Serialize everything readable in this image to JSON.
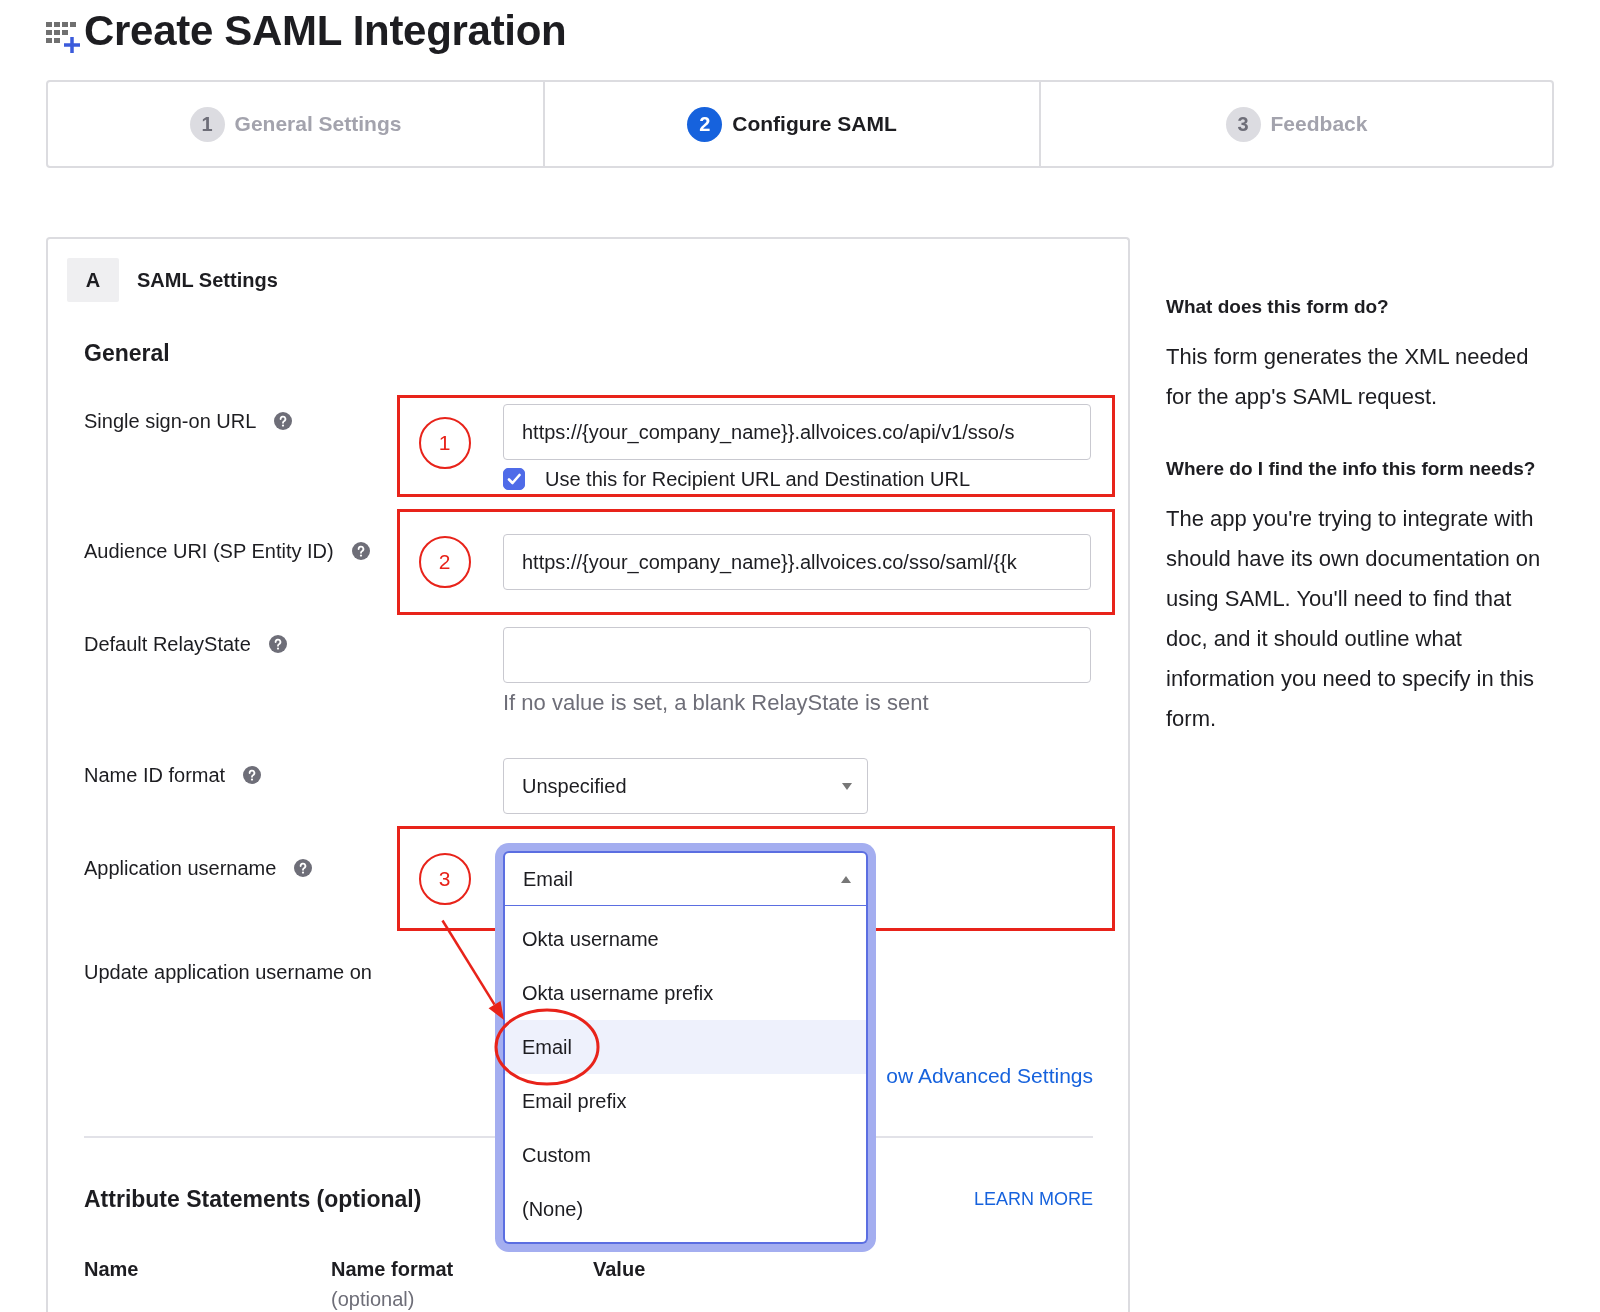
{
  "page": {
    "title": "Create SAML Integration"
  },
  "steps": [
    {
      "number": "1",
      "label": "General Settings",
      "selected": false
    },
    {
      "number": "2",
      "label": "Configure SAML",
      "selected": true
    },
    {
      "number": "3",
      "label": "Feedback",
      "selected": false
    }
  ],
  "card": {
    "badge": "A",
    "title": "SAML Settings",
    "section": "General",
    "fields": [
      {
        "kind": "text",
        "label": "Single sign-on URL",
        "help": true,
        "annotation": "1",
        "value": "https://{your_company_name}}.allvoices.co/api/v1/sso/s",
        "checkbox": {
          "label": "Use this for Recipient URL and Destination URL",
          "checked": true
        }
      },
      {
        "kind": "text",
        "label": "Audience URI (SP Entity ID)",
        "help": true,
        "annotation": "2",
        "value": "https://{your_company_name}}.allvoices.co/sso/saml/{{k"
      },
      {
        "kind": "text",
        "label": "Default RelayState",
        "help": true,
        "hint": "If no value is set, a blank RelayState is sent"
      },
      {
        "kind": "select",
        "label": "Name ID format",
        "help": true,
        "value": "Unspecified",
        "expanded": false
      },
      {
        "kind": "select",
        "label": "Application username",
        "help": true,
        "annotation": "3",
        "value": "Email",
        "expanded": true,
        "options": [
          {
            "label": "Okta username",
            "selected": false
          },
          {
            "label": "Okta username prefix",
            "selected": false
          },
          {
            "label": "Email",
            "selected": true,
            "circled": true
          },
          {
            "label": "Email prefix",
            "selected": false
          },
          {
            "label": "Custom",
            "selected": false
          },
          {
            "label": "(None)",
            "selected": false
          }
        ]
      },
      {
        "kind": "label",
        "label": "Update application username on"
      }
    ],
    "advanced_link": "ow Advanced Settings",
    "attributes": {
      "title": "Attribute Statements (optional)",
      "link": "LEARN MORE",
      "columns": [
        {
          "label": "Name"
        },
        {
          "label": "Name format",
          "note": "(optional)"
        },
        {
          "label": "Value"
        }
      ]
    }
  },
  "help_panel": [
    {
      "kind": "heading",
      "text": "What does this form do?"
    },
    {
      "kind": "paragraph",
      "text": "This form generates the XML needed for the app's SAML request."
    },
    {
      "kind": "heading",
      "text": "Where do I find the info this form needs?"
    },
    {
      "kind": "paragraph",
      "text": "The app you're trying to integrate with should have its own documentation on using SAML. You'll need to find that doc, and it should outline what information you need to specify in this form."
    }
  ]
}
